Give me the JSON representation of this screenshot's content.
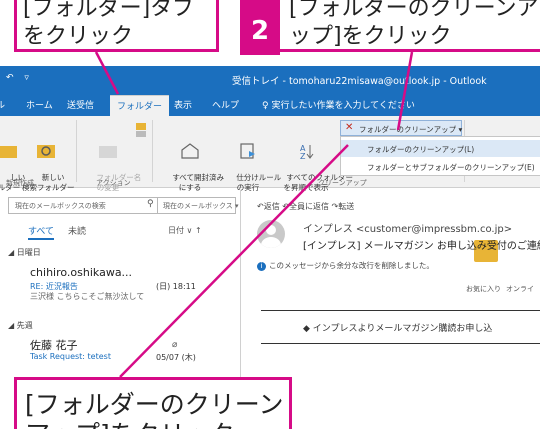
{
  "callouts": {
    "top_left": "[フォルダー]タブをクリック",
    "step_number": "2",
    "top_right": "[フォルダーのクリーンアップ]をクリック",
    "bottom": "[フォルダーのクリーンアップ]をクリック"
  },
  "window": {
    "qat": "↶ ▿",
    "title": "受信トレイ - tomoharu22misawa@outlook.jp - Outlook"
  },
  "tabs": [
    {
      "label": "ル"
    },
    {
      "label": "ホーム"
    },
    {
      "label": "送受信"
    },
    {
      "label": "フォルダー"
    },
    {
      "label": "表示"
    },
    {
      "label": "ヘルプ"
    }
  ],
  "tell_me": "♀ 実行したい作業を入力してください",
  "ribbon": {
    "new_folder_label": "しい\nルダー",
    "new_search_folder_label": "新しい\n検索フォルダー",
    "group_new": "新規作成",
    "rename_label": "フォルダー名\nの変更",
    "group_actions": "アクション",
    "mark_all_read_label": "すべて開封済み\nにする",
    "run_rules_label": "仕分けルール\nの実行",
    "show_all_folders_label": "すべてのフォルダー\nを昇順で表示",
    "cleanup_button": "フォルダーのクリーンアップ ▾",
    "group_cleanup": "クリーンアップ",
    "favorites": "お気に入り",
    "online": "オンライ"
  },
  "dropdown": {
    "item1": "フォルダーのクリーンアップ(L)",
    "item2": "フォルダーとサブフォルダーのクリーンアップ(E)"
  },
  "search": {
    "placeholder": "現在のメールボックスの検索",
    "scope": "現在のメールボックス ▾"
  },
  "filters": {
    "all": "すべて",
    "unread": "未読",
    "sort": "日付 ∨  ↑"
  },
  "groups": {
    "sunday": "◢ 日曜日",
    "last_week": "◢ 先週"
  },
  "messages": [
    {
      "from": "chihiro.oshikawa...",
      "subject": "RE: 近況報告",
      "date": "(日) 18:11",
      "preview": "三沢様 こちらこそご無沙汰して"
    },
    {
      "from": "佐藤 花子",
      "subject": "Task Request: tetest",
      "date": "05/07 (木)",
      "preview": ""
    }
  ],
  "reading": {
    "reply_bar": "↶返信  ↶全員に返信  ↷転送",
    "sender": "インプレス <customer@impressbm.co.jp>",
    "subject": "[インプレス] メールマガジン お申し込み受付のご連絡",
    "info": "このメッセージから余分な改行を削除しました。",
    "body_line": "◆ インプレスよりメールマガジン購読お申し込"
  },
  "colors": {
    "accent": "#d60b87",
    "outlook_blue": "#1b6fbe"
  }
}
